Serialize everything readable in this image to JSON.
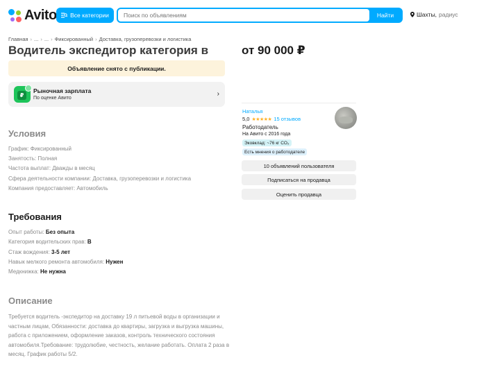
{
  "header": {
    "logo_text": "Avito",
    "categories_button": "Все категории",
    "search_placeholder": "Поиск по объявлениям",
    "search_button": "Найти",
    "location_city": "Шахты,",
    "location_radius": "радиус"
  },
  "breadcrumbs": [
    "Главная",
    "...",
    "...",
    "Фиксированный",
    "Доставка, грузоперевозки и логистика"
  ],
  "listing": {
    "title": "Водитель экспедитор категория в",
    "price": "от 90 000 ₽",
    "notice": "Объявление снято с публикации.",
    "salary_card": {
      "title": "Рыночная зарплата",
      "subtitle": "По оценке Авито"
    }
  },
  "conditions": {
    "title": "Условия",
    "rows": [
      {
        "key": "График:",
        "value": "Фиксированный"
      },
      {
        "key": "Занятость:",
        "value": "Полная"
      },
      {
        "key": "Частота выплат:",
        "value": "Дважды в месяц"
      },
      {
        "key": "Сфера деятельности компании:",
        "value": "Доставка, грузоперевозки и логистика"
      },
      {
        "key": "Компания предоставляет:",
        "value": "Автомобиль"
      }
    ]
  },
  "requirements": {
    "title": "Требования",
    "rows": [
      {
        "key": "Опыт работы:",
        "value": "Без опыта"
      },
      {
        "key": "Категория водительских прав:",
        "value": "B"
      },
      {
        "key": "Стаж вождения:",
        "value": "3-5 лет"
      },
      {
        "key": "Навык мелкого ремонта автомобиля:",
        "value": "Нужен"
      },
      {
        "key": "Медкнижка:",
        "value": "Не нужна"
      }
    ]
  },
  "description": {
    "title": "Описание",
    "text": "Требуется водитель -экспедитор на доставку 19 л питьевой воды в организации и частным лицам, Обязанности: доставка до квартиры, загрузка и выгрузка машины, работа с приложением, оформление заказов, контроль технического состояния автомобиля.Требование: трудолюбие, честность, желание работать. Оплата 2 раза в месяц. График работы 5/2."
  },
  "seller": {
    "name": "Наталья",
    "rating": "5,0",
    "stars": "★★★★★",
    "reviews": "15 отзывов",
    "type": "Работодатель",
    "since": "На Авито с 2016 года",
    "eco_badge": "Эковклад: ~76 кг CO₂",
    "opinion_badge": "Есть мнения о работодателе",
    "buttons": {
      "listings": "10 объявлений пользователя",
      "subscribe": "Подписаться на продавца",
      "rate": "Оценить продавца"
    }
  },
  "colors": {
    "accent": "#00aaff",
    "notice_bg": "#fdf3dc",
    "star": "#ffb021"
  }
}
